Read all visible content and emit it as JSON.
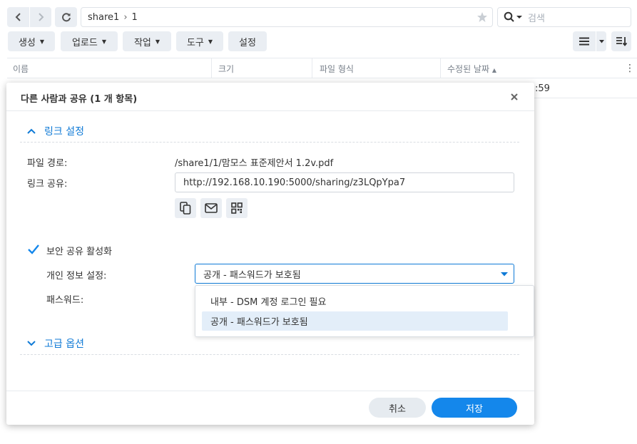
{
  "toolbar": {
    "path": [
      "share1",
      "1"
    ],
    "search_placeholder": "검색",
    "buttons": [
      "생성",
      "업로드",
      "작업",
      "도구",
      "설정"
    ]
  },
  "columns": [
    "이름",
    "크기",
    "파일 형식",
    "수정된 날짜"
  ],
  "file_row": {
    "time_fragment": ":59"
  },
  "dialog": {
    "title": "다른 사람과 공유 (1 개 항목)",
    "link_section": "링크 설정",
    "file_path_label": "파일 경로:",
    "file_path_value": "/share1/1/맘모스 표준제안서 1.2v.pdf",
    "share_link_label": "링크 공유:",
    "share_link_value": "http://192.168.10.190:5000/sharing/z3LQpYpa7",
    "secure_share_label": "보안 공유 활성화",
    "secure_share_checked": true,
    "privacy_label": "개인 정보 설정:",
    "privacy_selected": "공개 - 패스워드가 보호됨",
    "privacy_options": [
      "내부 - DSM 계정 로그인 필요",
      "공개 - 패스워드가 보호됨"
    ],
    "password_label": "패스워드:",
    "advanced_section": "고급 옵션",
    "cancel": "취소",
    "save": "저장"
  },
  "colors": {
    "accent": "#1487eb",
    "link_text": "#0f7ad6",
    "button_bg": "#eaeef3"
  }
}
